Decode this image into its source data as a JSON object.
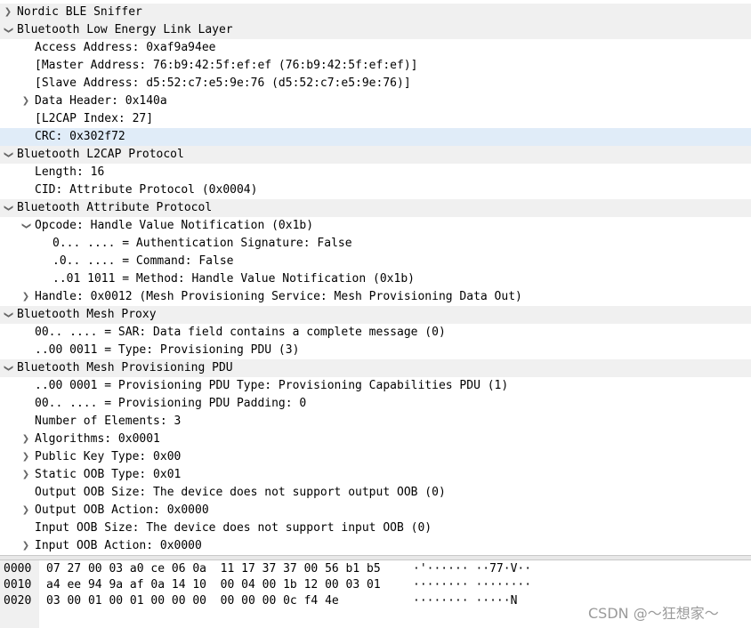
{
  "tree": [
    {
      "depth": 0,
      "arrow": "collapsed",
      "text": "Nordic BLE Sniffer",
      "hdr": true
    },
    {
      "depth": 0,
      "arrow": "expanded",
      "text": "Bluetooth Low Energy Link Layer",
      "hdr": true
    },
    {
      "depth": 1,
      "arrow": "none",
      "text": "Access Address: 0xaf9a94ee"
    },
    {
      "depth": 1,
      "arrow": "none",
      "text": "[Master Address: 76:b9:42:5f:ef:ef (76:b9:42:5f:ef:ef)]"
    },
    {
      "depth": 1,
      "arrow": "none",
      "text": "[Slave Address: d5:52:c7:e5:9e:76 (d5:52:c7:e5:9e:76)]"
    },
    {
      "depth": 1,
      "arrow": "collapsed",
      "text": "Data Header: 0x140a"
    },
    {
      "depth": 1,
      "arrow": "none",
      "text": "[L2CAP Index: 27]"
    },
    {
      "depth": 1,
      "arrow": "none",
      "text": "CRC: 0x302f72",
      "sel": true
    },
    {
      "depth": 0,
      "arrow": "expanded",
      "text": "Bluetooth L2CAP Protocol",
      "hdr": true
    },
    {
      "depth": 1,
      "arrow": "none",
      "text": "Length: 16"
    },
    {
      "depth": 1,
      "arrow": "none",
      "text": "CID: Attribute Protocol (0x0004)"
    },
    {
      "depth": 0,
      "arrow": "expanded",
      "text": "Bluetooth Attribute Protocol",
      "hdr": true
    },
    {
      "depth": 1,
      "arrow": "expanded",
      "text": "Opcode: Handle Value Notification (0x1b)"
    },
    {
      "depth": 2,
      "arrow": "none",
      "text": "0... .... = Authentication Signature: False"
    },
    {
      "depth": 2,
      "arrow": "none",
      "text": ".0.. .... = Command: False"
    },
    {
      "depth": 2,
      "arrow": "none",
      "text": "..01 1011 = Method: Handle Value Notification (0x1b)"
    },
    {
      "depth": 1,
      "arrow": "collapsed",
      "text": "Handle: 0x0012 (Mesh Provisioning Service: Mesh Provisioning Data Out)"
    },
    {
      "depth": 0,
      "arrow": "expanded",
      "text": "Bluetooth Mesh Proxy",
      "hdr": true
    },
    {
      "depth": 1,
      "arrow": "none",
      "text": "00.. .... = SAR: Data field contains a complete message (0)"
    },
    {
      "depth": 1,
      "arrow": "none",
      "text": "..00 0011 = Type: Provisioning PDU (3)"
    },
    {
      "depth": 0,
      "arrow": "expanded",
      "text": "Bluetooth Mesh Provisioning PDU",
      "hdr": true
    },
    {
      "depth": 1,
      "arrow": "none",
      "text": "..00 0001 = Provisioning PDU Type: Provisioning Capabilities PDU (1)"
    },
    {
      "depth": 1,
      "arrow": "none",
      "text": "00.. .... = Provisioning PDU Padding: 0"
    },
    {
      "depth": 1,
      "arrow": "none",
      "text": "Number of Elements: 3"
    },
    {
      "depth": 1,
      "arrow": "collapsed",
      "text": "Algorithms: 0x0001"
    },
    {
      "depth": 1,
      "arrow": "collapsed",
      "text": "Public Key Type: 0x00"
    },
    {
      "depth": 1,
      "arrow": "collapsed",
      "text": "Static OOB Type: 0x01"
    },
    {
      "depth": 1,
      "arrow": "none",
      "text": "Output OOB Size: The device does not support output OOB (0)"
    },
    {
      "depth": 1,
      "arrow": "collapsed",
      "text": "Output OOB Action: 0x0000"
    },
    {
      "depth": 1,
      "arrow": "none",
      "text": "Input OOB Size: The device does not support input OOB (0)"
    },
    {
      "depth": 1,
      "arrow": "collapsed",
      "text": "Input OOB Action: 0x0000"
    }
  ],
  "hex": [
    {
      "offset": "0000",
      "bytes": "07 27 00 03 a0 ce 06 0a  11 17 37 37 00 56 b1 b5",
      "ascii": "·'······ ··77·V··"
    },
    {
      "offset": "0010",
      "bytes": "a4 ee 94 9a af 0a 14 10  00 04 00 1b 12 00 03 01",
      "ascii": "········ ········"
    },
    {
      "offset": "0020",
      "bytes": "03 00 01 00 01 00 00 00  00 00 00 0c f4 4e",
      "ascii": "········ ·····N"
    }
  ],
  "icons": {
    "collapsed": "chevron-right-icon",
    "expanded": "chevron-down-icon"
  },
  "glyphs": {
    "collapsed": "❯",
    "expanded": "❯"
  },
  "colors": {
    "header_bg": "#f0f0f0",
    "selected_bg": "#e0ecf8",
    "offset_bg": "#f0f0f0"
  },
  "watermark": "CSDN @～狂想家～"
}
